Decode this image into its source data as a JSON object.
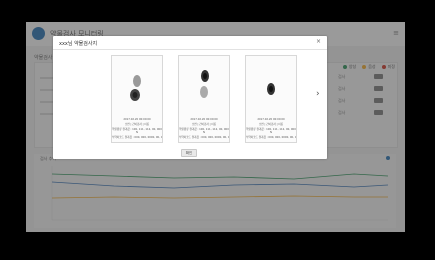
{
  "app": {
    "title": "약물검사 모니터링",
    "section_label": "약물검사 결과",
    "legend": [
      {
        "label": "양성",
        "color": "#2e8b57"
      },
      {
        "label": "음성",
        "color": "#e0a030"
      },
      {
        "label": "미정",
        "color": "#c0392b"
      }
    ],
    "table_cells": [
      "검사",
      "검사",
      "검사",
      "검사"
    ],
    "chart_title": "검사 추이"
  },
  "modal": {
    "title": "xxx님 약물검사지",
    "close_label": "×",
    "ok_label": "확인",
    "next_label": "›",
    "cards": [
      {
        "date": "2017.02.20 00:00:00",
        "info": "소변 | 간이검사 | 이름",
        "meta_a": "약물종류 결과값 : 100, 111, 112, 00, 000",
        "meta_b": "N",
        "meta_c": "식약처코드 결과값 : 000, 000, 0000, 00, 00"
      },
      {
        "date": "2017.02.20 00:00:00",
        "info": "소변 | 간이검사 | 이름",
        "meta_a": "약물종류 결과값 : 100, 111, 112, 00, 000",
        "meta_b": "N",
        "meta_c": "식약처코드 결과값 : 000, 000, 0000, 00, 00"
      },
      {
        "date": "2017.02.20 00:00:00",
        "info": "소변 | 간이검사 | 이름",
        "meta_a": "약물종류 결과값 : 100, 111, 112, 00, 000",
        "meta_b": "N",
        "meta_c": "식약처코드 결과값 : 000, 000, 0000, 00, 00"
      }
    ]
  }
}
